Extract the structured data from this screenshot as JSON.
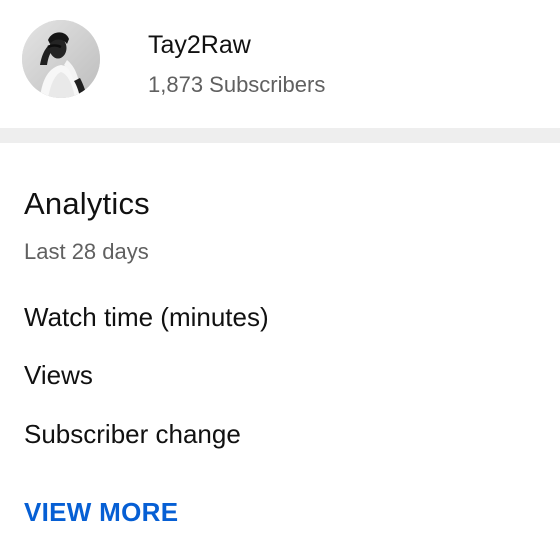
{
  "channel": {
    "name": "Tay2Raw",
    "subscribers": "1,873 Subscribers"
  },
  "analytics": {
    "title": "Analytics",
    "period": "Last 28 days",
    "metrics": [
      {
        "label": "Watch time (minutes)"
      },
      {
        "label": "Views"
      },
      {
        "label": "Subscriber change"
      }
    ],
    "view_more_label": "VIEW MORE"
  },
  "colors": {
    "link": "#065fd4",
    "secondary_text": "#606060",
    "divider": "#eeeeee"
  }
}
